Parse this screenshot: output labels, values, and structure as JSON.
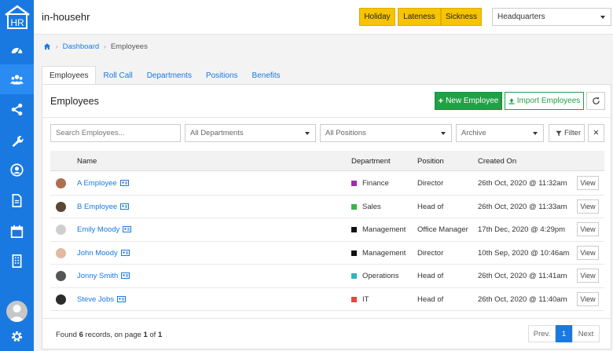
{
  "app": {
    "title": "in-househr",
    "logo_text": "HR"
  },
  "sidebar": {
    "items": [
      {
        "name": "dashboard-icon"
      },
      {
        "name": "users-icon"
      },
      {
        "name": "share-icon"
      },
      {
        "name": "wrench-icon"
      },
      {
        "name": "user-circle-icon"
      },
      {
        "name": "document-icon"
      },
      {
        "name": "calendar-icon"
      },
      {
        "name": "building-icon"
      }
    ],
    "active_index": 1,
    "settings_icon": "gear-icon"
  },
  "header": {
    "buttons": [
      "Holiday",
      "Lateness",
      "Sickness"
    ],
    "location": "Headquarters"
  },
  "breadcrumb": {
    "home_icon": "home-icon",
    "dashboard": "Dashboard",
    "current": "Employees"
  },
  "tabs": [
    "Employees",
    "Roll Call",
    "Departments",
    "Positions",
    "Benefits"
  ],
  "panel": {
    "title": "Employees",
    "new_button": "New Employee",
    "import_button": "Import Employees",
    "refresh_icon": "refresh-icon"
  },
  "filters": {
    "search_placeholder": "Search Employees...",
    "departments": "All Departments",
    "positions": "All Positions",
    "archive": "Archive",
    "filter_label": "Filter",
    "clear_icon": "close-icon"
  },
  "table": {
    "columns": [
      "Name",
      "Department",
      "Position",
      "Created On"
    ],
    "rows": [
      {
        "name": "A Employee",
        "department": "Finance",
        "dept_color": "#9b2fae",
        "position": "Director",
        "created": "26th Oct, 2020 @ 11:32am",
        "view": "View"
      },
      {
        "name": "B Employee",
        "department": "Sales",
        "dept_color": "#3cb34a",
        "position": "Head of",
        "created": "26th Oct, 2020 @ 11:33am",
        "view": "View"
      },
      {
        "name": "Emily Moody",
        "department": "Management",
        "dept_color": "#111111",
        "position": "Office Manager",
        "created": "17th Dec, 2020 @ 4:29pm",
        "view": "View"
      },
      {
        "name": "John Moody",
        "department": "Management",
        "dept_color": "#111111",
        "position": "Director",
        "created": "10th Sep, 2020 @ 10:46am",
        "view": "View"
      },
      {
        "name": "Jonny Smith",
        "department": "Operations",
        "dept_color": "#2ab7c6",
        "position": "Head of",
        "created": "26th Oct, 2020 @ 11:41am",
        "view": "View"
      },
      {
        "name": "Steve Jobs",
        "department": "IT",
        "dept_color": "#e8473c",
        "position": "Head of",
        "created": "26th Oct, 2020 @ 11:40am",
        "view": "View"
      }
    ]
  },
  "footer": {
    "found_prefix": "Found ",
    "count": "6",
    "mid": " records, on page ",
    "page": "1",
    "of": " of ",
    "pages": "1",
    "prev": "Prev.",
    "current": "1",
    "next": "Next"
  },
  "colors": {
    "primary": "#1a79e0",
    "success": "#22a046",
    "warning": "#f6c400"
  }
}
